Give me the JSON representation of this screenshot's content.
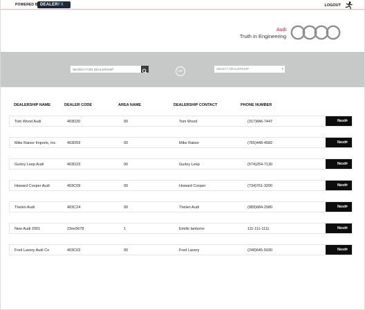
{
  "header": {
    "powered_by": "POWERED BY",
    "logo_prefix": "DEALER",
    "logo_suffix": "FX",
    "logout": "LOGOUT"
  },
  "brand": {
    "name": "Audi",
    "tagline": "Truth in Engineering"
  },
  "search": {
    "placeholder": "SEARCH FOR DEALERSHIP",
    "or_label": "OR",
    "select_placeholder": "SELECT DEALERSHIP"
  },
  "table": {
    "headers": [
      "DEALERSHIP NAME",
      "DEALER CODE",
      "AREA NAME",
      "DEALERSHIP CONTACT",
      "PHONE NUMBER"
    ],
    "next_label": "Next",
    "rows": [
      {
        "name": "Tom Wood Audi",
        "code": "403D20",
        "area": "00",
        "contact": "Tom Wood",
        "phone": "(317)846-7447"
      },
      {
        "name": "Mike Raisor Imports, Inc.",
        "code": "403D59",
        "area": "00",
        "contact": "Mike Raisor",
        "phone": "(765)448-4582"
      },
      {
        "name": "Gurley Leep Audi",
        "code": "403D23",
        "area": "00",
        "contact": "Gurley Leep",
        "phone": "(574)254-7130"
      },
      {
        "name": "Howard Cooper Audi",
        "code": "403C09",
        "area": "00",
        "contact": "Howard Cooper",
        "phone": "(734)761-3200"
      },
      {
        "name": "Thelen Audi",
        "code": "403C24",
        "area": "00",
        "contact": "Thelen Audi",
        "phone": "(989)684-2980"
      },
      {
        "name": "New Audi 2001",
        "code": "23ee5678",
        "area": "1",
        "contact": "Emilio Iantorno",
        "phone": "111-111-1111"
      },
      {
        "name": "Fred Lavery Audi Co",
        "code": "403C03",
        "area": "00",
        "contact": "Fred Lavery",
        "phone": "(248)645-5930"
      }
    ]
  },
  "colors": {
    "accent": "#c8102e",
    "band": "#c7c9c9",
    "button": "#0d0d0d"
  }
}
